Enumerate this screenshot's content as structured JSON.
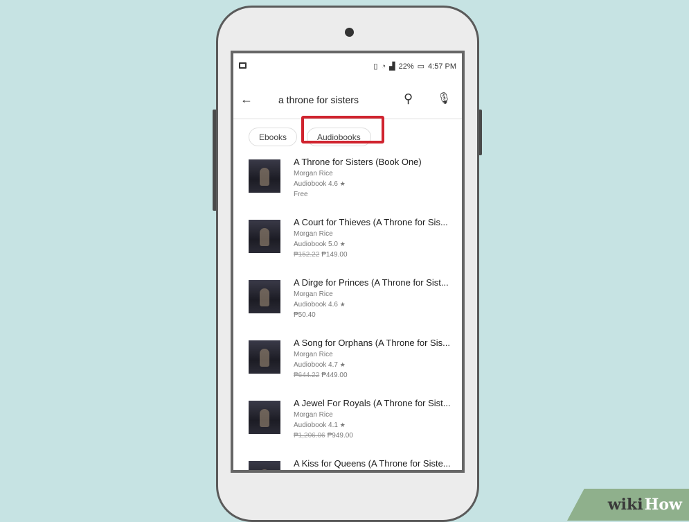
{
  "status_bar": {
    "battery": "22%",
    "time": "4:57 PM"
  },
  "search": {
    "query": "a throne for sisters"
  },
  "chips": [
    {
      "label": "Ebooks"
    },
    {
      "label": "Audiobooks",
      "selected": true
    }
  ],
  "results": [
    {
      "title": "A Throne for Sisters (Book One)",
      "author": "Morgan Rice",
      "type": "Audiobook",
      "rating": "4.6",
      "old_price": "",
      "price": "Free"
    },
    {
      "title": "A Court for Thieves (A Throne for Sis...",
      "author": "Morgan Rice",
      "type": "Audiobook",
      "rating": "5.0",
      "old_price": "₱152.22",
      "price": "₱149.00"
    },
    {
      "title": "A Dirge for Princes (A Throne for Sist...",
      "author": "Morgan Rice",
      "type": "Audiobook",
      "rating": "4.6",
      "old_price": "",
      "price": "₱50.40"
    },
    {
      "title": "A Song for Orphans (A Throne for Sis...",
      "author": "Morgan Rice",
      "type": "Audiobook",
      "rating": "4.7",
      "old_price": "₱644.22",
      "price": "₱449.00"
    },
    {
      "title": "A Jewel For Royals (A Throne for Sist...",
      "author": "Morgan Rice",
      "type": "Audiobook",
      "rating": "4.1",
      "old_price": "₱1,206.06",
      "price": "₱949.00"
    },
    {
      "title": "A Kiss for Queens (A Throne for Siste...",
      "author": "",
      "type": "",
      "rating": "",
      "old_price": "",
      "price": ""
    }
  ],
  "watermark": {
    "wiki": "wiki",
    "how": "How"
  },
  "colors": {
    "highlight": "#d0232e",
    "background": "#c6e3e3"
  }
}
